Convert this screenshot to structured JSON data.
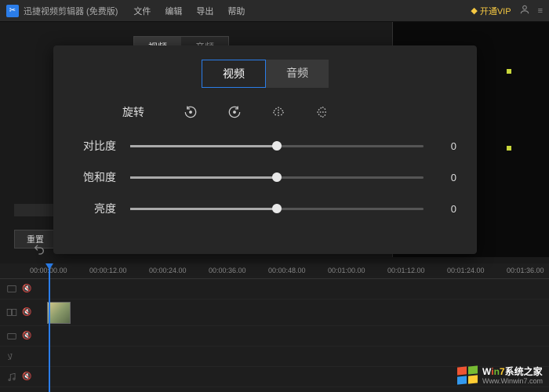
{
  "app": {
    "title": "迅捷视频剪辑器 (免费版)"
  },
  "menu": {
    "file": "文件",
    "edit": "编辑",
    "export": "导出",
    "help": "帮助"
  },
  "titlebar": {
    "vip": "开通VIP"
  },
  "bg_tabs": {
    "video": "视频",
    "audio": "音频"
  },
  "dialog": {
    "tabs": {
      "video": "视频",
      "audio": "音频"
    },
    "rotate_label": "旋转",
    "sliders": [
      {
        "label": "对比度",
        "value": "0",
        "pos": 50
      },
      {
        "label": "饱和度",
        "value": "0",
        "pos": 50
      },
      {
        "label": "亮度",
        "value": "0",
        "pos": 50
      }
    ]
  },
  "buttons": {
    "reset": "重置"
  },
  "ruler": [
    "00:00:00.00",
    "00:00:12.00",
    "00:00:24.00",
    "00:00:36.00",
    "00:00:48.00",
    "00:01:00.00",
    "00:01:12.00",
    "00:01:24.00",
    "00:01:36.00"
  ],
  "watermark": {
    "title_prefix": "W",
    "title_colored": "in7",
    "title_suffix": "系统之家",
    "url": "Www.Winwin7.com"
  }
}
